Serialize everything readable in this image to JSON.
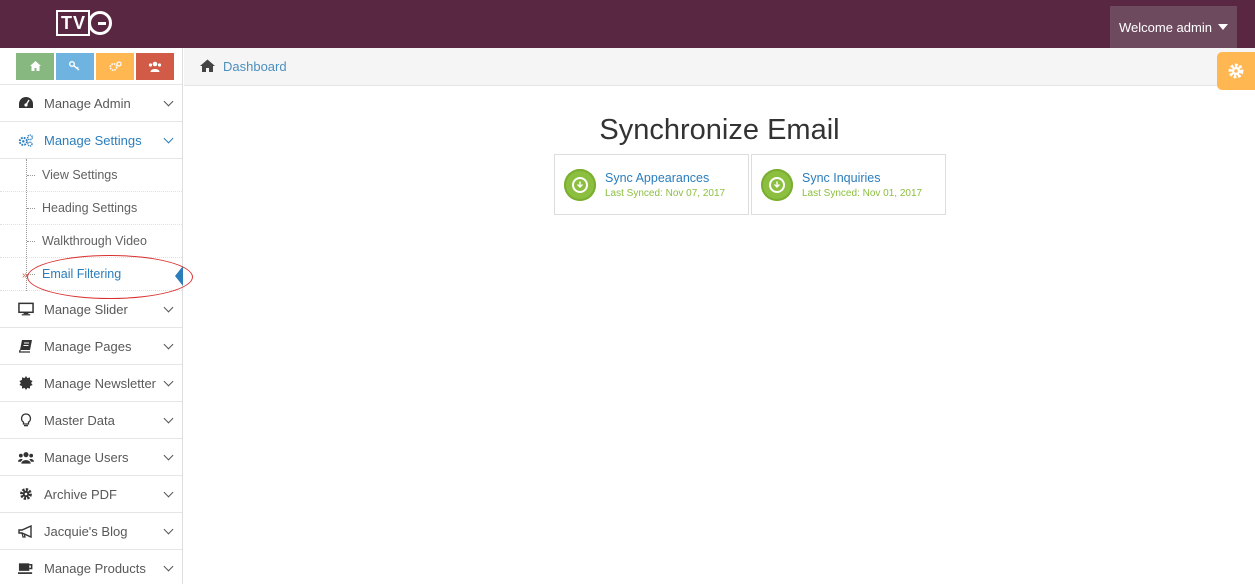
{
  "header": {
    "logo_text": "TVG",
    "welcome_label": "Welcome admin"
  },
  "sidebar": {
    "shortcuts": [
      {
        "name": "home",
        "color": "#87b87f"
      },
      {
        "name": "key",
        "color": "#6fb3e0"
      },
      {
        "name": "cogs",
        "color": "#ffb752"
      },
      {
        "name": "users",
        "color": "#d15b47"
      }
    ],
    "items": [
      {
        "label": "Manage Admin",
        "icon": "dashboard-icon"
      },
      {
        "label": "Manage Settings",
        "icon": "cogs-icon",
        "open": true,
        "sub": [
          "View Settings",
          "Heading Settings",
          "Walkthrough Video",
          "Email Filtering"
        ],
        "active_sub": "Email Filtering"
      },
      {
        "label": "Manage Slider",
        "icon": "monitor-icon"
      },
      {
        "label": "Manage Pages",
        "icon": "book-icon"
      },
      {
        "label": "Manage Newsletter",
        "icon": "certificate-icon"
      },
      {
        "label": "Master Data",
        "icon": "lightbulb-icon"
      },
      {
        "label": "Manage Users",
        "icon": "users-icon"
      },
      {
        "label": "Archive PDF",
        "icon": "cog-icon"
      },
      {
        "label": "Jacquie's Blog",
        "icon": "megaphone-icon"
      },
      {
        "label": "Manage Products",
        "icon": "coffee-icon"
      }
    ]
  },
  "breadcrumb": {
    "home_label": "Dashboard"
  },
  "main": {
    "title": "Synchronize Email",
    "cards": [
      {
        "title": "Sync Appearances",
        "subtitle": "Last Synced: Nov 07, 2017"
      },
      {
        "title": "Sync Inquiries",
        "subtitle": "Last Synced: Nov 01, 2017"
      }
    ]
  },
  "colors": {
    "topbar": "#5a2742",
    "accent_blue": "#2b7dbc",
    "sync_green": "#8cbf3f",
    "settings_orange": "#ffb752"
  }
}
